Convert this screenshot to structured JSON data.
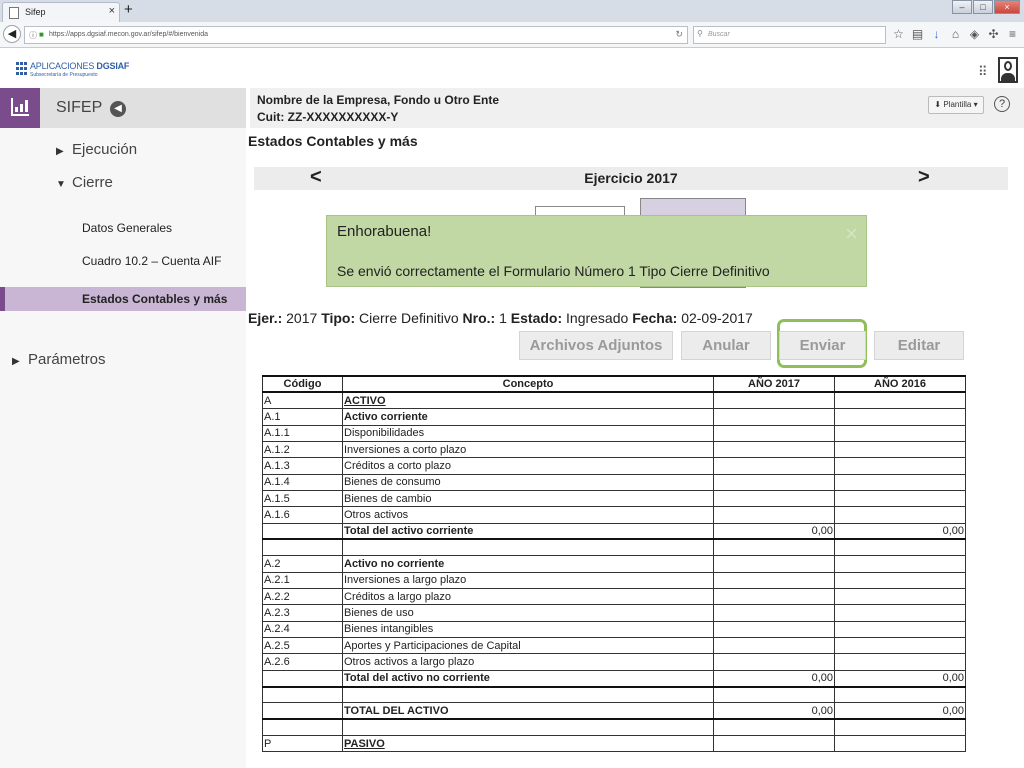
{
  "browser": {
    "tab_title": "Sifep",
    "tab_close": "×",
    "new_tab": "+",
    "url": "https://apps.dgsiaf.mecon.gov.ar/sifep/#/bienvenida",
    "search_placeholder": "Buscar"
  },
  "header": {
    "logo_title_prefix": "APLICACIONES ",
    "logo_title_bold": "DGSIAF",
    "logo_subtitle": "Subsecretaría de Presupuesto"
  },
  "sidebar": {
    "title": "SIFEP",
    "items": [
      {
        "label": "Ejecución",
        "arrow": "▶"
      },
      {
        "label": "Cierre",
        "arrow": "▼"
      },
      {
        "label": "Parámetros",
        "arrow": "▶"
      }
    ],
    "subitems": [
      "Datos Generales",
      "Cuadro 10.2  – Cuenta AIF"
    ],
    "active_item": "Estados Contables y más"
  },
  "company": {
    "name": "Nombre de la Empresa, Fondo u Otro Ente",
    "cuit": "Cuit: ZZ-XXXXXXXXXX-Y",
    "plantilla_label": "Plantilla",
    "help": "?"
  },
  "main": {
    "page_title": "Estados Contables y más",
    "prev": "<",
    "next": ">",
    "year_label": "Ejercicio 2017"
  },
  "alert": {
    "title": "Enhorabuena!",
    "message": "Se envió correctamente el Formulario Número 1 Tipo Cierre Definitivo",
    "close": "×"
  },
  "info": {
    "ejer_label": "Ejer.:",
    "ejer_value": " 2017 ",
    "tipo_label": "Tipo:",
    "tipo_value": " Cierre Definitivo  ",
    "nro_label": "Nro.:",
    "nro_value": " 1 ",
    "estado_label": "Estado:",
    "estado_value": " Ingresado ",
    "fecha_label": "Fecha:",
    "fecha_value": " 02-09-2017"
  },
  "actions": {
    "adjuntos": "Archivos Adjuntos",
    "anular": "Anular",
    "enviar": "Enviar",
    "editar": "Editar"
  },
  "table": {
    "headers": [
      "Código",
      "Concepto",
      "AÑO 2017",
      "AÑO 2016"
    ],
    "rows": [
      {
        "code": "A",
        "concept": "ACTIVO",
        "y2017": "",
        "y2016": "",
        "style": "u"
      },
      {
        "code": "A.1",
        "concept": "Activo corriente",
        "y2017": "",
        "y2016": "",
        "style": "b"
      },
      {
        "code": "A.1.1",
        "concept": "Disponibilidades",
        "y2017": "",
        "y2016": "",
        "style": ""
      },
      {
        "code": "A.1.2",
        "concept": "Inversiones a corto plazo",
        "y2017": "",
        "y2016": "",
        "style": ""
      },
      {
        "code": "A.1.3",
        "concept": "Créditos a corto plazo",
        "y2017": "",
        "y2016": "",
        "style": ""
      },
      {
        "code": "A.1.4",
        "concept": "Bienes de consumo",
        "y2017": "",
        "y2016": "",
        "style": ""
      },
      {
        "code": "A.1.5",
        "concept": "Bienes de cambio",
        "y2017": "",
        "y2016": "",
        "style": ""
      },
      {
        "code": "A.1.6",
        "concept": "Otros activos",
        "y2017": "",
        "y2016": "",
        "style": ""
      },
      {
        "code": "",
        "concept": "Total del activo corriente",
        "y2017": "0,00",
        "y2016": "0,00",
        "style": "total"
      },
      {
        "code": "",
        "concept": "",
        "y2017": "",
        "y2016": "",
        "style": ""
      },
      {
        "code": "A.2",
        "concept": "Activo no corriente",
        "y2017": "",
        "y2016": "",
        "style": "b"
      },
      {
        "code": "A.2.1",
        "concept": "Inversiones a largo plazo",
        "y2017": "",
        "y2016": "",
        "style": ""
      },
      {
        "code": "A.2.2",
        "concept": "Créditos a largo plazo",
        "y2017": "",
        "y2016": "",
        "style": ""
      },
      {
        "code": "A.2.3",
        "concept": "Bienes de uso",
        "y2017": "",
        "y2016": "",
        "style": ""
      },
      {
        "code": "A.2.4",
        "concept": "Bienes intangibles",
        "y2017": "",
        "y2016": "",
        "style": ""
      },
      {
        "code": "A.2.5",
        "concept": "Aportes y Participaciones de Capital",
        "y2017": "",
        "y2016": "",
        "style": ""
      },
      {
        "code": "A.2.6",
        "concept": "Otros activos a largo plazo",
        "y2017": "",
        "y2016": "",
        "style": ""
      },
      {
        "code": "",
        "concept": "Total del activo no corriente",
        "y2017": "0,00",
        "y2016": "0,00",
        "style": "total"
      },
      {
        "code": "",
        "concept": "",
        "y2017": "",
        "y2016": "",
        "style": ""
      },
      {
        "code": "",
        "concept": "TOTAL DEL ACTIVO",
        "y2017": "0,00",
        "y2016": "0,00",
        "style": "total"
      },
      {
        "code": "",
        "concept": "",
        "y2017": "",
        "y2016": "",
        "style": ""
      },
      {
        "code": "P",
        "concept": "PASIVO",
        "y2017": "",
        "y2016": "",
        "style": "u"
      }
    ]
  },
  "colors": {
    "accent_purple": "#7a4c8c",
    "active_bg": "#c9b6d5",
    "alert_green": "#c1d7a4",
    "focus_ring": "#8fbf5a"
  }
}
